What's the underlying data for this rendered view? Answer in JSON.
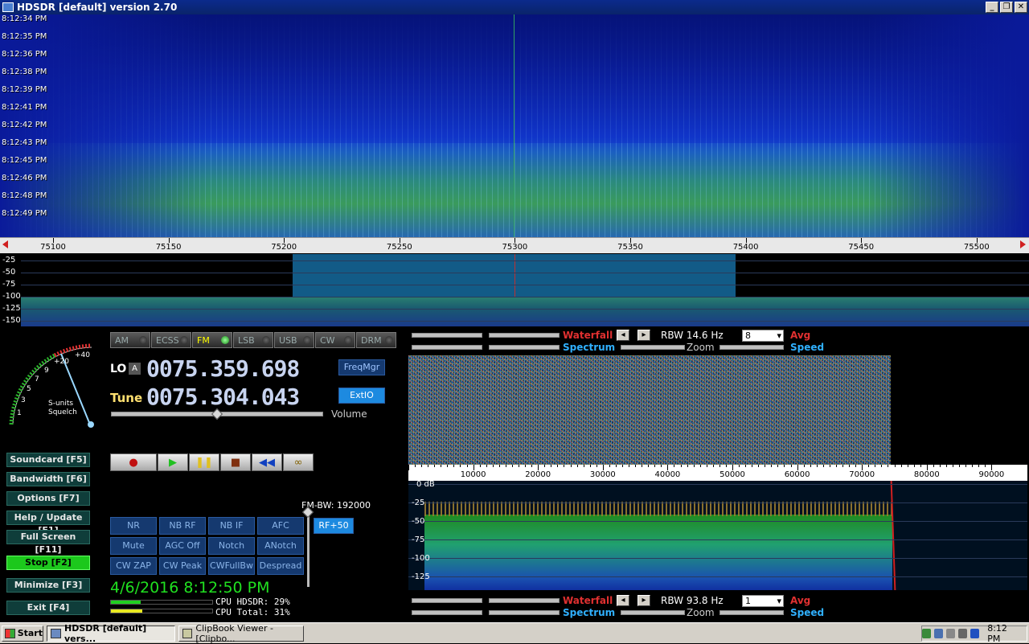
{
  "window": {
    "title": "HDSDR [default]  version 2.70"
  },
  "waterfall_main": {
    "timestamps": [
      "8:12:34 PM",
      "8:12:35 PM",
      "8:12:36 PM",
      "8:12:38 PM",
      "8:12:39 PM",
      "8:12:41 PM",
      "8:12:42 PM",
      "8:12:43 PM",
      "8:12:45 PM",
      "8:12:46 PM",
      "8:12:48 PM",
      "8:12:49 PM"
    ],
    "freq_ticks": [
      "75100",
      "75150",
      "75200",
      "75250",
      "75300",
      "75350",
      "75400",
      "75450",
      "75500"
    ]
  },
  "spectrum_main": {
    "db_labels": [
      "-25",
      "-50",
      "-75",
      "-100",
      "-125",
      "-150"
    ]
  },
  "smeter": {
    "labels": [
      "+40",
      "+20",
      "9",
      "7",
      "5",
      "3",
      "1"
    ],
    "caption1": "S-units",
    "caption2": "Squelch"
  },
  "modes": [
    {
      "label": "AM",
      "active": false
    },
    {
      "label": "ECSS",
      "active": false
    },
    {
      "label": "FM",
      "active": true
    },
    {
      "label": "LSB",
      "active": false
    },
    {
      "label": "USB",
      "active": false
    },
    {
      "label": "CW",
      "active": false
    },
    {
      "label": "DRM",
      "active": false
    }
  ],
  "lo": {
    "label": "LO",
    "badge": "A",
    "value": "0075.359.698"
  },
  "tune": {
    "label": "Tune",
    "value": "0075.304.043"
  },
  "buttons": {
    "freqmgr": "FreqMgr",
    "extio": "ExtIO",
    "rf": "RF+50"
  },
  "volume": {
    "label": "Volume",
    "level": 0.48
  },
  "side_buttons": [
    {
      "label": "Soundcard  [F5]",
      "style": "normal"
    },
    {
      "label": "Bandwidth  [F6]",
      "style": "normal"
    },
    {
      "label": "Options  [F7]",
      "style": "normal"
    },
    {
      "label": "Help / Update  [F1]",
      "style": "normal"
    },
    {
      "label": "Full Screen  [F11]",
      "style": "normal"
    },
    {
      "label": "Stop  [F2]",
      "style": "go"
    },
    {
      "label": "Minimize  [F3]",
      "style": "normal"
    },
    {
      "label": "Exit  [F4]",
      "style": "normal"
    }
  ],
  "fm_bw": "FM-BW: 192000",
  "dsp_buttons": [
    "NR",
    "NB RF",
    "NB IF",
    "AFC",
    "Mute",
    "AGC Off",
    "Notch",
    "ANotch",
    "CW ZAP",
    "CW Peak",
    "CWFullBw",
    "Despread"
  ],
  "status": {
    "datetime": "4/6/2016 8:12:50 PM",
    "cpu_hdsdr": "CPU HDSDR: 29%",
    "cpu_total": "CPU Total: 31%",
    "cpu_hdsdr_level": 0.29,
    "cpu_total_level": 0.31
  },
  "upper_ctl": {
    "waterfall": "Waterfall",
    "spectrum": "Spectrum",
    "rbw": "RBW 14.6 Hz",
    "avg_value": "8",
    "avg": "Avg",
    "zoom": "Zoom",
    "speed": "Speed"
  },
  "lower_ctl": {
    "waterfall": "Waterfall",
    "spectrum": "Spectrum",
    "rbw": "RBW 93.8 Hz",
    "avg_value": "1",
    "avg": "Avg",
    "zoom": "Zoom",
    "speed": "Speed"
  },
  "af_ruler": [
    "10000",
    "20000",
    "30000",
    "40000",
    "50000",
    "60000",
    "70000",
    "80000",
    "90000"
  ],
  "af_spectrum": {
    "db_labels": [
      "0 dB",
      "-25",
      "-50",
      "-75",
      "-100",
      "-125"
    ]
  },
  "taskbar": {
    "start": "Start",
    "tasks": [
      {
        "label": "HDSDR [default]  vers...",
        "active": true
      },
      {
        "label": "ClipBook Viewer - [Clipbo...",
        "active": false
      }
    ],
    "clock": "8:12 PM"
  },
  "colors": {
    "waterfall_label": "#e03030",
    "spectrum_label": "#30b0ff",
    "accent_green": "#20e020"
  }
}
